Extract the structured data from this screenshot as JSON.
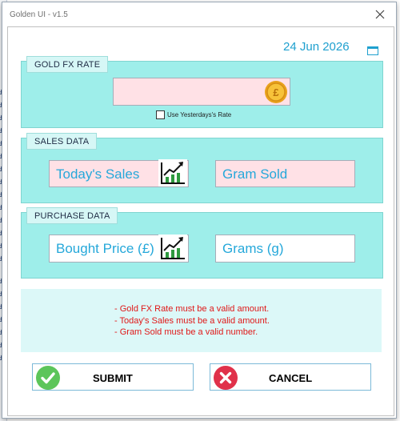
{
  "window": {
    "title": "Golden UI - v1.5"
  },
  "date": {
    "value": "24 Jun 2026"
  },
  "gold_fx": {
    "section_title": "GOLD FX RATE",
    "rate_value": "",
    "use_yesterday_label": "Use Yesterdays's Rate",
    "use_yesterday_checked": false
  },
  "sales": {
    "section_title": "SALES DATA",
    "todays_sales_placeholder": "Today's Sales",
    "gram_sold_placeholder": "Gram Sold"
  },
  "purchase": {
    "section_title": "PURCHASE DATA",
    "bought_price_placeholder": "Bought Price (£)",
    "grams_placeholder": "Grams (g)"
  },
  "messages": [
    "- Gold FX Rate must be a valid amount.",
    "- Today's Sales must be a valid amount.",
    "- Gram Sold must be a valid number."
  ],
  "buttons": {
    "submit_label": "SUBMIT",
    "cancel_label": "CANCEL"
  },
  "background_sheet": {
    "cells": [
      "£",
      "£",
      "£",
      "£",
      "£",
      "£",
      "£",
      "£",
      "£",
      "£",
      "£",
      "£",
      "£",
      "£",
      "£",
      "£",
      "£",
      "£",
      "£",
      "£",
      "£"
    ]
  },
  "colors": {
    "section_bg": "#9eeeea",
    "accent_text": "#1fa0cf",
    "error_text": "#e01818",
    "invalid_field": "#ffe1e6",
    "submit_green": "#5cc55a",
    "cancel_red": "#e0314a"
  },
  "icons": {
    "close": "close-icon",
    "calendar": "calendar-icon",
    "coin": "gold-coin-pound-icon",
    "trend": "trend-chart-icon",
    "submit": "checkmark-circle-icon",
    "cancel": "x-circle-icon"
  }
}
